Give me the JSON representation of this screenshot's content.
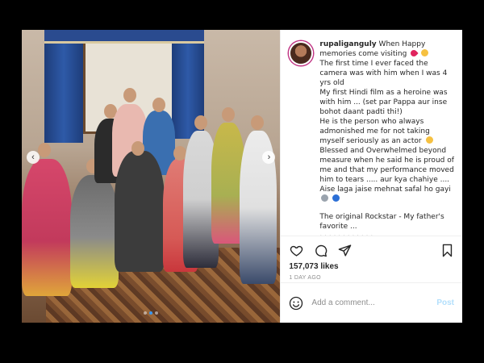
{
  "post": {
    "username": "rupaliganguly",
    "caption_lines": [
      "When Happy memories come visiting",
      "The first time I ever faced the camera was with him when I was 4 yrs old",
      "My first Hindi film as a heroine was with him ... (set par Pappa aur inse bohot daant padti thi!)",
      "He is the person who always admonished me for not taking myself seriously as an actor",
      "Blessed and Overwhelmed beyond measure when he said he is proud of me and that my performance moved him to tears ..... aur kya chahiye ....",
      "Aise laga jaise mehnat safal ho gayi"
    ],
    "caption_second": "The original Rockstar - My father's favorite ...",
    "likes": "157,073 likes",
    "time_ago": "1 DAY AGO"
  },
  "comment": {
    "placeholder": "Add a comment...",
    "post_label": "Post"
  },
  "photo": {
    "left_arrow": "‹",
    "right_arrow": "›"
  },
  "colors": {
    "accent": "#3897f0",
    "post_button_disabled": "#b2dffc",
    "text": "#262626",
    "muted": "#8e8e8e"
  },
  "icons": [
    "heart-icon",
    "comment-icon",
    "share-icon",
    "bookmark-icon",
    "smile-icon"
  ]
}
